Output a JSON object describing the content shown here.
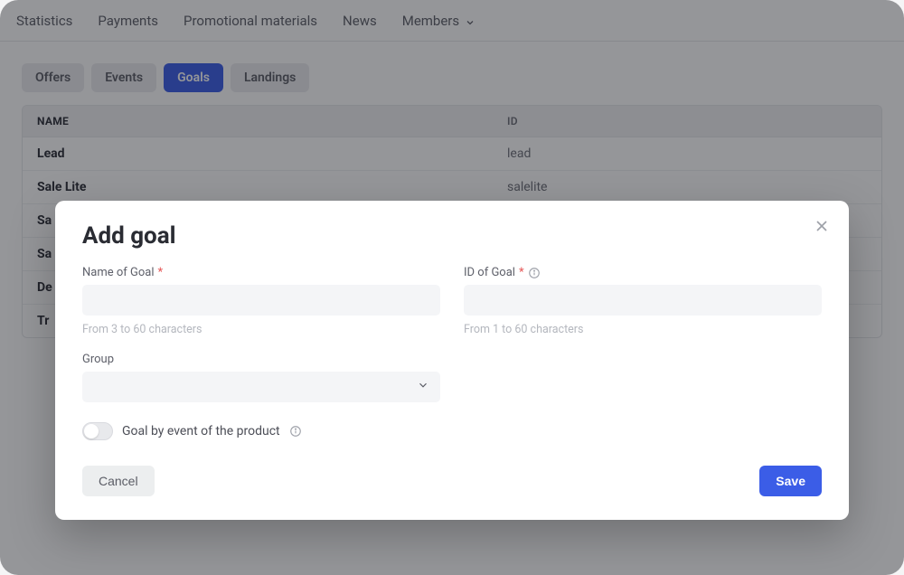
{
  "nav": {
    "items": [
      "Statistics",
      "Payments",
      "Promotional materials",
      "News",
      "Members"
    ]
  },
  "tabs": {
    "items": [
      {
        "label": "Offers",
        "active": false
      },
      {
        "label": "Events",
        "active": false
      },
      {
        "label": "Goals",
        "active": true
      },
      {
        "label": "Landings",
        "active": false
      }
    ]
  },
  "table": {
    "head": {
      "name": "NAME",
      "id": "ID"
    },
    "rows": [
      {
        "name": "Lead",
        "id": "lead"
      },
      {
        "name": "Sale Lite",
        "id": "salelite"
      },
      {
        "name": "Sa",
        "id": ""
      },
      {
        "name": "Sa",
        "id": ""
      },
      {
        "name": "De",
        "id": ""
      },
      {
        "name": "Tr",
        "id": ""
      }
    ]
  },
  "modal": {
    "title": "Add goal",
    "name_label": "Name of Goal",
    "name_hint": "From 3 to 60 characters",
    "id_label": "ID of Goal",
    "id_hint": "From 1 to 60 characters",
    "group_label": "Group",
    "toggle_label": "Goal by event of the product",
    "cancel": "Cancel",
    "save": "Save",
    "required": "*"
  }
}
